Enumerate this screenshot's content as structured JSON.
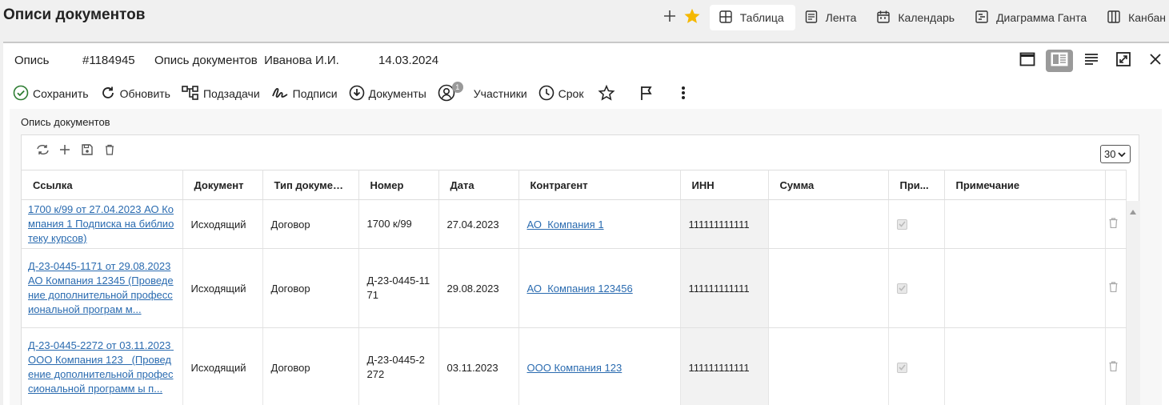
{
  "page": {
    "title": "Описи документов"
  },
  "views": {
    "tabs": [
      {
        "label": "Таблица",
        "icon": "table-icon",
        "active": true
      },
      {
        "label": "Лента",
        "icon": "feed-icon",
        "active": false
      },
      {
        "label": "Календарь",
        "icon": "calendar-icon",
        "active": false
      },
      {
        "label": "Диаграмма Ганта",
        "icon": "gantt-icon",
        "active": false
      },
      {
        "label": "Канбан",
        "icon": "kanban-icon",
        "active": false
      }
    ]
  },
  "card": {
    "type": "Опись",
    "number": "#1184945",
    "name": "Опись документов  Иванова И.И.",
    "date": "14.03.2024"
  },
  "toolbar": {
    "save": "Сохранить",
    "refresh": "Обновить",
    "subtasks": "Подзадачи",
    "signatures": "Подписи",
    "documents": "Документы",
    "participants": "Участники",
    "participants_count": "1",
    "deadline": "Срок"
  },
  "section": {
    "title": "Опись документов"
  },
  "grid": {
    "page_size": "30",
    "columns": [
      "Ссылка",
      "Документ",
      "Тип документа",
      "Номер",
      "Дата",
      "Контрагент",
      "ИНН",
      "Сумма",
      "При...",
      "Примечание"
    ],
    "rows": [
      {
        "link": "1700 к/99 от 27.04.2023 АО Компания 1  Подписка на библиотеку курсов)",
        "document": "Исходящий",
        "doc_type": "Договор",
        "number": "1700 к/99",
        "date": "27.04.2023",
        "counterparty": "АО  Компания 1",
        "inn": "111111111111",
        "sum": "",
        "note": ""
      },
      {
        "link": "Д-23-0445-1171 от 29.08.2023 АО Компания 12345 (Проведение дополнительной профессиональной програм м...",
        "document": "Исходящий",
        "doc_type": "Договор",
        "number": "Д-23-0445-1171",
        "date": "29.08.2023",
        "counterparty": "АО  Компания 123456",
        "inn": "111111111111",
        "sum": "",
        "note": ""
      },
      {
        "link": "Д-23-0445-2272 от 03.11.2023 ООО Компания 123   (Проведение дополнительной профессиональной программ ы п...",
        "document": "Исходящий",
        "doc_type": "Договор",
        "number": "Д-23-0445-2272",
        "date": "03.11.2023",
        "counterparty": "ООО Компания 123",
        "inn": "111111111111",
        "sum": "",
        "note": ""
      }
    ]
  }
}
